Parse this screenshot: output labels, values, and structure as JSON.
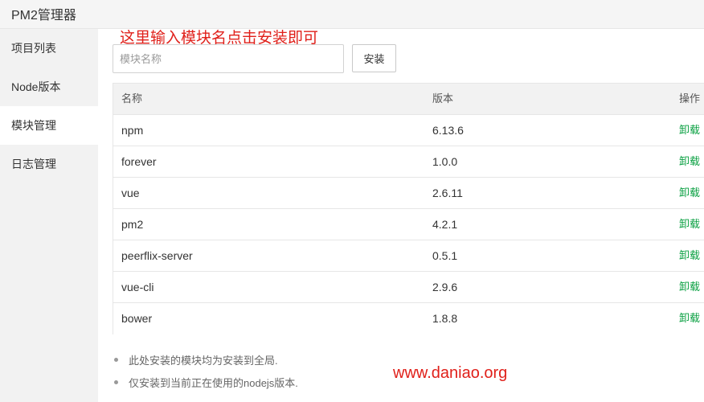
{
  "app": {
    "title": "PM2管理器"
  },
  "sidebar": {
    "items": [
      {
        "label": "项目列表",
        "active": false
      },
      {
        "label": "Node版本",
        "active": false
      },
      {
        "label": "模块管理",
        "active": true
      },
      {
        "label": "日志管理",
        "active": false
      }
    ]
  },
  "annotation": {
    "text": "这里输入模块名点击安装即可",
    "color": "#e0201a"
  },
  "search": {
    "placeholder": "模块名称",
    "value": ""
  },
  "install_button": {
    "label": "安装"
  },
  "table": {
    "headers": {
      "name": "名称",
      "version": "版本",
      "action": "操作"
    },
    "rows": [
      {
        "name": "npm",
        "version": "6.13.6",
        "action": "卸载"
      },
      {
        "name": "forever",
        "version": "1.0.0",
        "action": "卸载"
      },
      {
        "name": "vue",
        "version": "2.6.11",
        "action": "卸载"
      },
      {
        "name": "pm2",
        "version": "4.2.1",
        "action": "卸载"
      },
      {
        "name": "peerflix-server",
        "version": "0.5.1",
        "action": "卸载"
      },
      {
        "name": "vue-cli",
        "version": "2.9.6",
        "action": "卸载"
      },
      {
        "name": "bower",
        "version": "1.8.8",
        "action": "卸载"
      }
    ]
  },
  "notes": [
    "此处安装的模块均为安装到全局.",
    "仅安装到当前正在使用的nodejs版本."
  ],
  "watermark": {
    "text": "www.daniao.org"
  },
  "colors": {
    "accent_green": "#0aa042",
    "annotation_red": "#e0201a"
  }
}
